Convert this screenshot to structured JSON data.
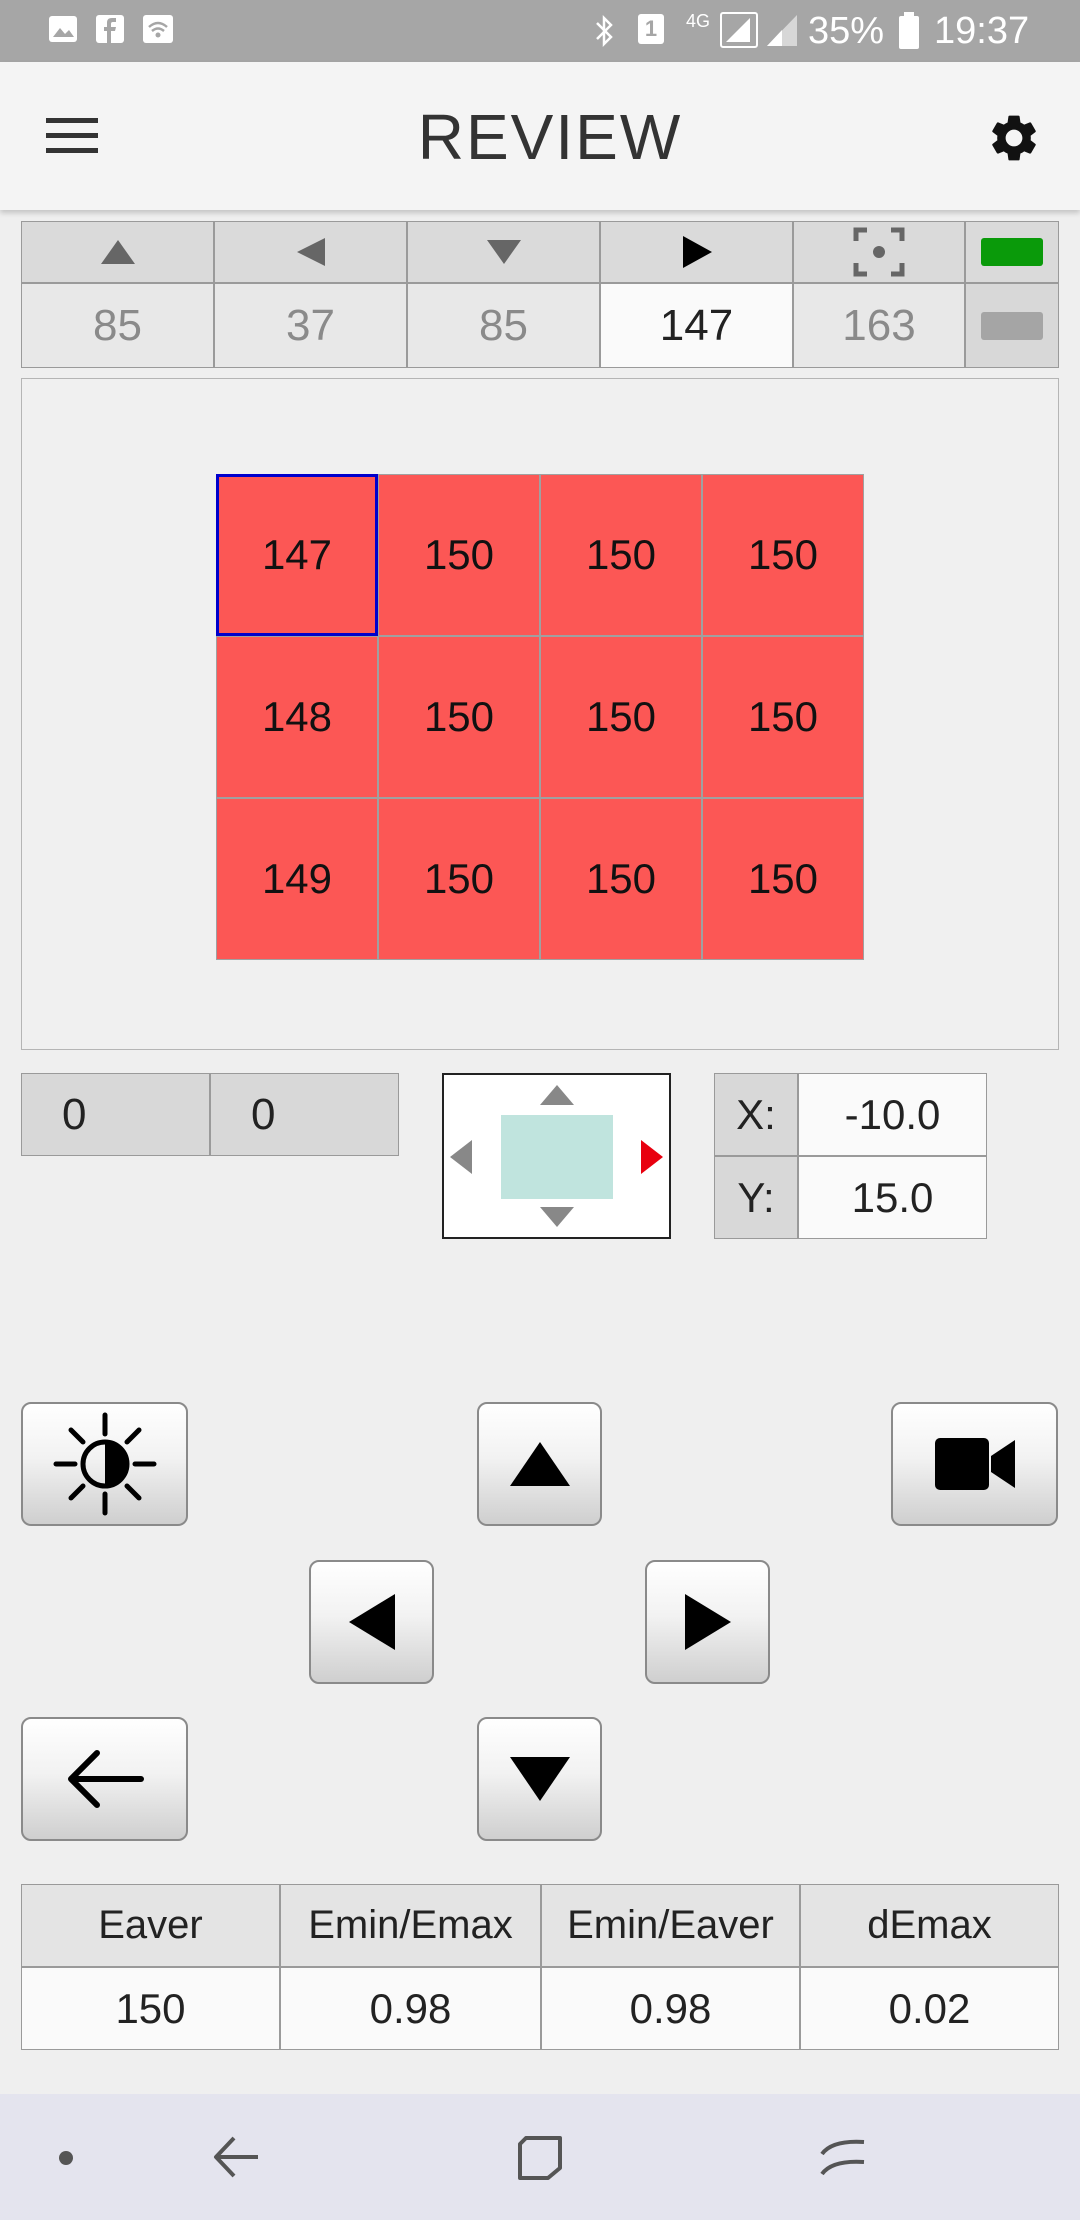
{
  "status_bar": {
    "battery": "35%",
    "time": "19:37",
    "network": "4G",
    "sim_slot": "1",
    "icons": [
      "gallery-icon",
      "facebook-icon",
      "wifi-icon",
      "bluetooth-icon",
      "sim-icon",
      "network-4g-icon",
      "signal-icon",
      "signal-icon",
      "battery-icon"
    ]
  },
  "app_bar": {
    "title": "REVIEW",
    "menu_icon": "menu-icon",
    "settings_icon": "gear-icon"
  },
  "direction_tabs": [
    {
      "icon": "triangle-up-icon",
      "value": "85",
      "active": false
    },
    {
      "icon": "triangle-left-icon",
      "value": "37",
      "active": false
    },
    {
      "icon": "triangle-down-icon",
      "value": "85",
      "active": false
    },
    {
      "icon": "triangle-right-icon",
      "value": "147",
      "active": true
    },
    {
      "icon": "focus-icon",
      "value": "163",
      "active": false
    }
  ],
  "indicators": {
    "top_color": "#0a9a0a",
    "bottom_color": "#a5a5a5"
  },
  "grid": {
    "rows": [
      [
        "147",
        "150",
        "150",
        "150"
      ],
      [
        "148",
        "150",
        "150",
        "150"
      ],
      [
        "149",
        "150",
        "150",
        "150"
      ]
    ],
    "selected": [
      0,
      0
    ],
    "cell_color": "#fc5755",
    "selected_border_color": "#0000cc"
  },
  "offsets": [
    "0",
    "0"
  ],
  "position_pad": {
    "active_direction": "right",
    "active_color": "#e8000f",
    "box_color": "#c0e4de"
  },
  "coords": {
    "x_label": "X:",
    "x": "-10.0",
    "y_label": "Y:",
    "y": "15.0"
  },
  "controls": {
    "brightness_icon": "brightness-icon",
    "camera_icon": "video-camera-icon",
    "up_icon": "arrow-up-icon",
    "down_icon": "arrow-down-icon",
    "left_icon": "arrow-left-icon",
    "right_icon": "arrow-right-icon",
    "back_icon": "back-arrow-icon"
  },
  "results": {
    "headers": [
      "Eaver",
      "Emin/Emax",
      "Emin/Eaver",
      "dEmax"
    ],
    "values": [
      "150",
      "0.98",
      "0.98",
      "0.02"
    ]
  },
  "nav_bar": {
    "icons": [
      "dot-icon",
      "back-icon",
      "home-icon",
      "recents-icon"
    ]
  }
}
